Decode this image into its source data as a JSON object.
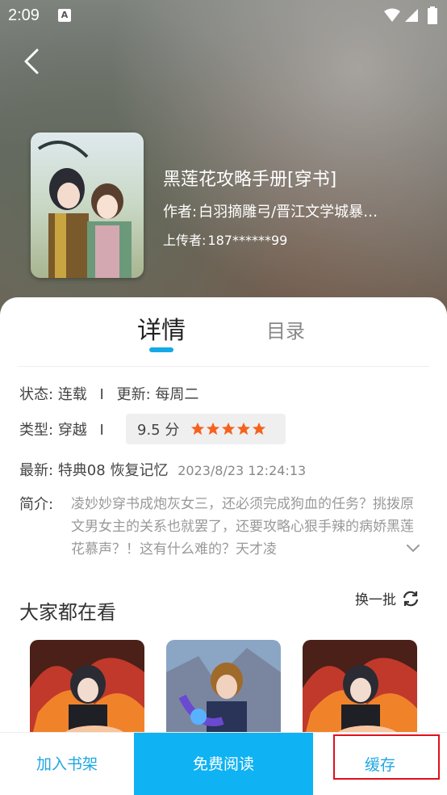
{
  "status_bar": {
    "time": "2:09",
    "notif_glyph": "A"
  },
  "book": {
    "title": "黑莲花攻略手册[穿书]",
    "author_label": "作者:",
    "author": "白羽摘雕弓/晋江文学城暴…",
    "uploader_label": "上传者:",
    "uploader": "187******99"
  },
  "tabs": {
    "detail": "详情",
    "toc": "目录"
  },
  "info": {
    "status_label": "状态:",
    "status": "连载",
    "separator": "I",
    "update_label": "更新:",
    "update": "每周二",
    "type_label": "类型:",
    "type": "穿越",
    "score": "9.5 分",
    "rating_stars": 5,
    "latest_label": "最新:",
    "latest": "特典08 恢复记忆",
    "latest_time": "2023/8/23 12:24:13",
    "intro_label": "简介:",
    "intro": "凌妙妙穿书成炮灰女三，还必须完成狗血的任务？挑拨原文男女主的关系也就罢了，还要攻略心狠手辣的病娇黑莲花慕声？！这有什么难的？天才凌"
  },
  "recommend": {
    "title": "大家都在看",
    "refresh_label": "换一批"
  },
  "bottom": {
    "shelf": "加入书架",
    "read": "免费阅读",
    "cache": "缓存"
  },
  "colors": {
    "accent": "#0fb2f2",
    "star": "#f5621e",
    "highlight": "#e0101c"
  }
}
